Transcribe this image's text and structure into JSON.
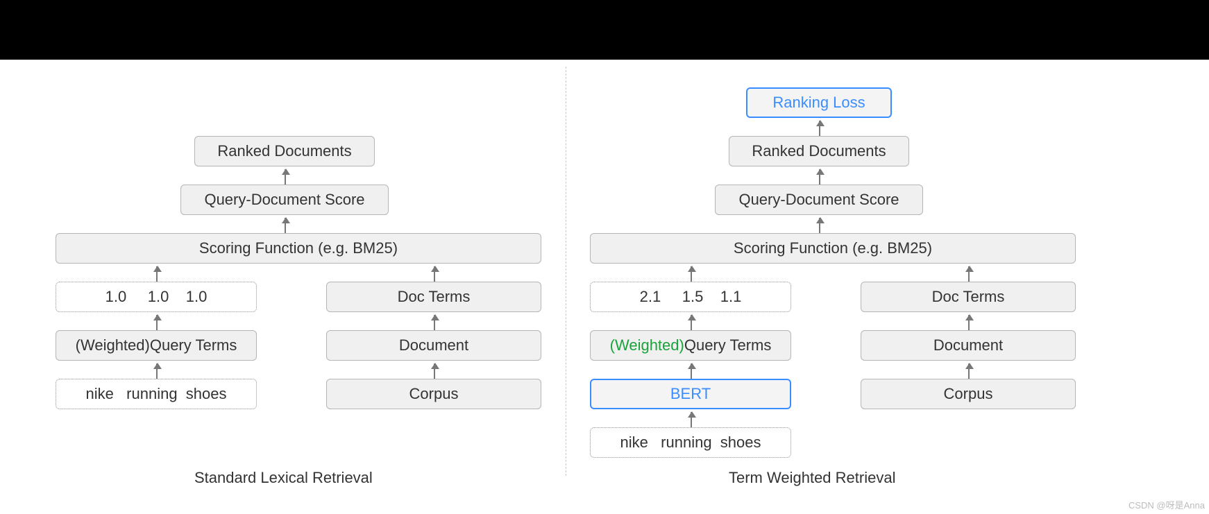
{
  "left": {
    "caption": "Standard Lexical Retrieval",
    "ranked": "Ranked Documents",
    "score": "Query-Document Score",
    "scorefn": "Scoring Function (e.g. BM25)",
    "weights": "1.0     1.0    1.0",
    "docterms": "Doc Terms",
    "queryterms_pre": "(Weighted) ",
    "queryterms_post": "Query Terms",
    "document": "Document",
    "query": "nike   running  shoes",
    "corpus": "Corpus"
  },
  "right": {
    "caption": "Term Weighted Retrieval",
    "loss": "Ranking Loss",
    "ranked": "Ranked Documents",
    "score": "Query-Document Score",
    "scorefn": "Scoring Function (e.g. BM25)",
    "weights": "2.1     1.5    1.1",
    "docterms": "Doc Terms",
    "queryterms_pre": "(Weighted) ",
    "queryterms_post": "Query Terms",
    "document": "Document",
    "bert": "BERT",
    "corpus": "Corpus",
    "query": "nike   running  shoes"
  },
  "watermark": "CSDN @呀是Anna"
}
